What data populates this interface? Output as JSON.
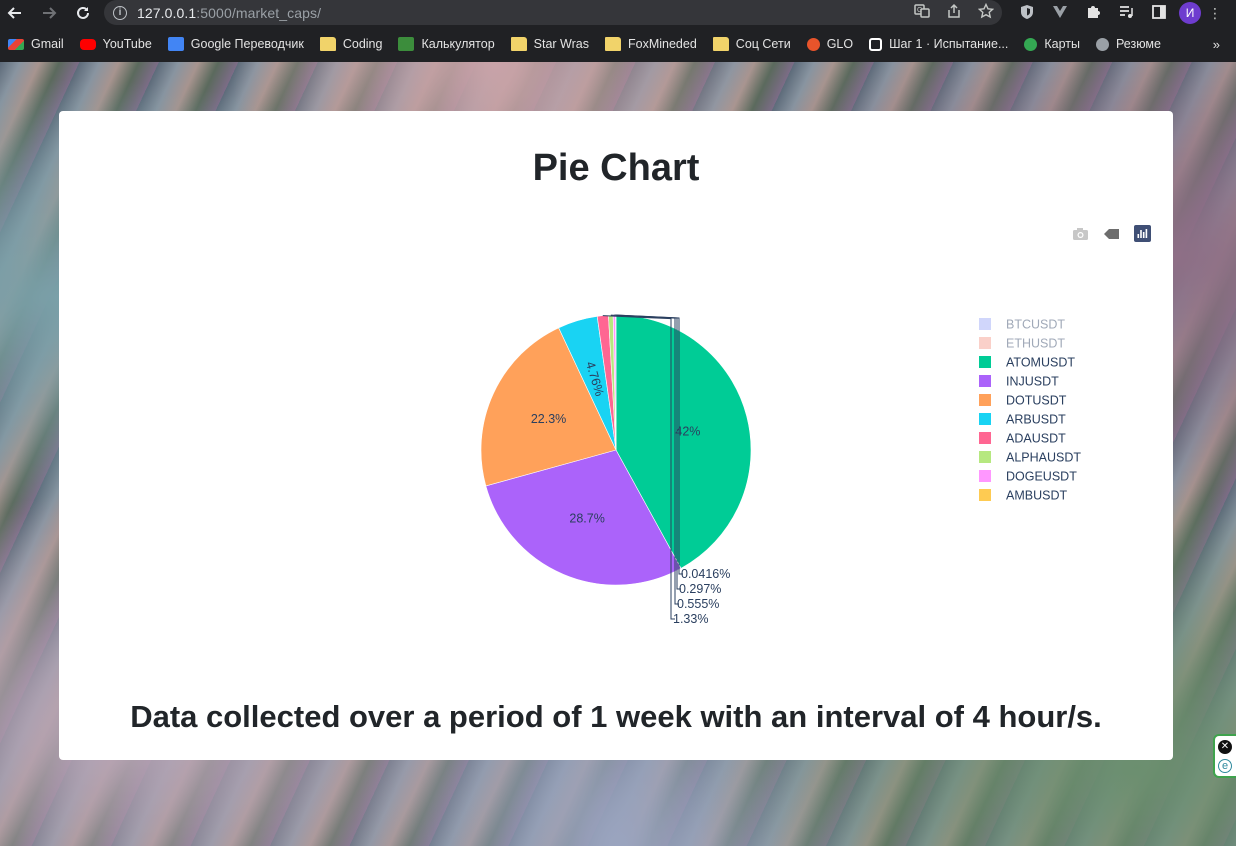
{
  "browser": {
    "url_host": "127.0.0.1",
    "url_rest": ":5000/market_caps/",
    "avatar_initial": "И"
  },
  "bookmarks": [
    {
      "label": "Gmail",
      "icon": "gmail-icon",
      "color": "#ea4335"
    },
    {
      "label": "YouTube",
      "icon": "youtube-icon",
      "color": "#ff0000"
    },
    {
      "label": "Google Переводчик",
      "icon": "translate-icon",
      "color": "#4285f4"
    },
    {
      "label": "Coding",
      "icon": "folder-icon",
      "color": "#f1d36a"
    },
    {
      "label": "Калькулятор",
      "icon": "calculator-icon",
      "color": "#3c8d3c"
    },
    {
      "label": "Star Wras",
      "icon": "folder-icon",
      "color": "#f1d36a"
    },
    {
      "label": "FoxMineded",
      "icon": "folder-icon",
      "color": "#f1d36a"
    },
    {
      "label": "Соц Сети",
      "icon": "folder-icon",
      "color": "#f1d36a"
    },
    {
      "label": "GLO",
      "icon": "glo-icon",
      "color": "#e8542b"
    },
    {
      "label": "Шаг 1 · Испытание...",
      "icon": "stepik-icon",
      "color": "#ffffff"
    },
    {
      "label": "Карты",
      "icon": "maps-icon",
      "color": "#34a853"
    },
    {
      "label": "Резюме",
      "icon": "globe-icon",
      "color": "#9aa0a6"
    }
  ],
  "page": {
    "title": "Pie Chart",
    "footer": "Data collected over a period of 1 week with an interval of 4 hour/s."
  },
  "chart_data": {
    "type": "pie",
    "title": "",
    "legend_position": "right",
    "slices": [
      {
        "label": "BTCUSDT",
        "value": 0,
        "text": "",
        "color": "#aab4f8",
        "legend_dimmed": true
      },
      {
        "label": "ETHUSDT",
        "value": 0,
        "text": "",
        "color": "#f6a99d",
        "legend_dimmed": true
      },
      {
        "label": "ATOMUSDT",
        "value": 42.0,
        "text": "42%",
        "color": "#00cc96",
        "legend_dimmed": false
      },
      {
        "label": "INJUSDT",
        "value": 28.7,
        "text": "28.7%",
        "color": "#ab63fa",
        "legend_dimmed": false
      },
      {
        "label": "DOTUSDT",
        "value": 22.3,
        "text": "22.3%",
        "color": "#ffa15a",
        "legend_dimmed": false
      },
      {
        "label": "ARBUSDT",
        "value": 4.76,
        "text": "4.76%",
        "color": "#19d3f3",
        "legend_dimmed": false
      },
      {
        "label": "ADAUSDT",
        "value": 1.33,
        "text": "1.33%",
        "color": "#ff6692",
        "legend_dimmed": false
      },
      {
        "label": "ALPHAUSDT",
        "value": 0.555,
        "text": "0.555%",
        "color": "#b6e880",
        "legend_dimmed": false
      },
      {
        "label": "DOGEUSDT",
        "value": 0.297,
        "text": "0.297%",
        "color": "#ff97ff",
        "legend_dimmed": false
      },
      {
        "label": "AMBUSDT",
        "value": 0.0416,
        "text": "0.0416%",
        "color": "#fecb52",
        "legend_dimmed": false
      }
    ]
  }
}
